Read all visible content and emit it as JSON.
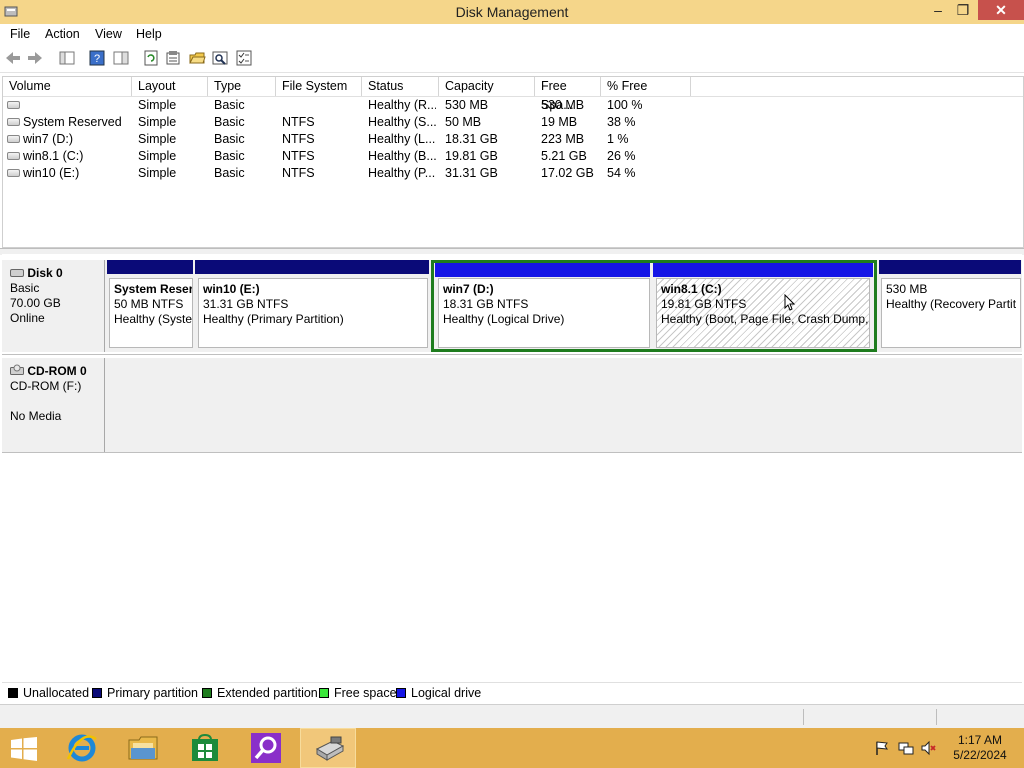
{
  "window": {
    "title": "Disk Management"
  },
  "menu": [
    "File",
    "Action",
    "View",
    "Help"
  ],
  "volume_table": {
    "columns": [
      "Volume",
      "Layout",
      "Type",
      "File System",
      "Status",
      "Capacity",
      "Free Spa...",
      "% Free"
    ],
    "rows": [
      [
        "",
        "Simple",
        "Basic",
        "",
        "Healthy (R...",
        "530 MB",
        "530 MB",
        "100 %"
      ],
      [
        "System Reserved",
        "Simple",
        "Basic",
        "NTFS",
        "Healthy (S...",
        "50 MB",
        "19 MB",
        "38 %"
      ],
      [
        "win7 (D:)",
        "Simple",
        "Basic",
        "NTFS",
        "Healthy (L...",
        "18.31 GB",
        "223 MB",
        "1 %"
      ],
      [
        "win8.1 (C:)",
        "Simple",
        "Basic",
        "NTFS",
        "Healthy (B...",
        "19.81 GB",
        "5.21 GB",
        "26 %"
      ],
      [
        "win10 (E:)",
        "Simple",
        "Basic",
        "NTFS",
        "Healthy (P...",
        "31.31 GB",
        "17.02 GB",
        "54 %"
      ]
    ]
  },
  "disk0": {
    "name": "Disk 0",
    "type": "Basic",
    "size": "70.00 GB",
    "state": "Online",
    "partitions": [
      {
        "name": "System Reser",
        "size": "50 MB NTFS",
        "status": "Healthy (Syste"
      },
      {
        "name": "win10  (E:)",
        "size": "31.31 GB NTFS",
        "status": "Healthy (Primary Partition)"
      },
      {
        "name": "win7  (D:)",
        "size": "18.31 GB NTFS",
        "status": "Healthy (Logical Drive)"
      },
      {
        "name": "win8.1  (C:)",
        "size": "19.81 GB NTFS",
        "status": "Healthy (Boot, Page File, Crash Dump,"
      },
      {
        "name": "",
        "size": "530 MB",
        "status": "Healthy (Recovery Partit"
      }
    ]
  },
  "cdrom0": {
    "name": "CD-ROM 0",
    "device": "CD-ROM (F:)",
    "media": "No Media"
  },
  "legend": [
    "Unallocated",
    "Primary partition",
    "Extended partition",
    "Free space",
    "Logical drive"
  ],
  "legend_colors": [
    "#000000",
    "#0a0a78",
    "#1e7c1e",
    "#3be83b",
    "#1515e6"
  ],
  "taskbar": {
    "apps": [
      "internet-explorer-icon",
      "file-explorer-icon",
      "store-icon",
      "search-icon",
      "disk-management-icon"
    ]
  },
  "clock": {
    "time": "1:17 AM",
    "date": "5/22/2024"
  }
}
